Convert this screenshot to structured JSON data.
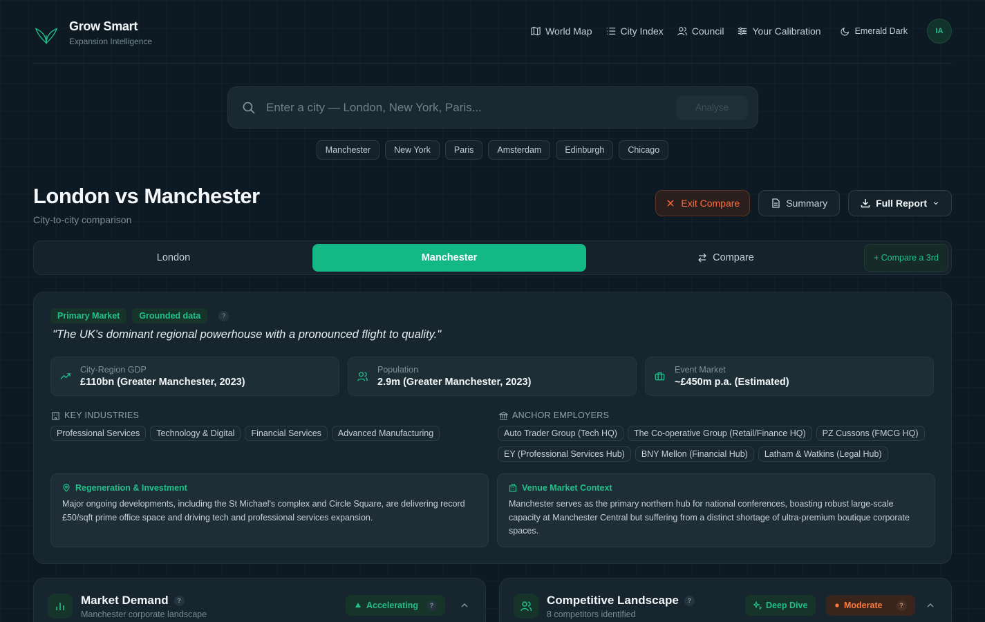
{
  "brand": {
    "name": "Grow Smart",
    "tagline": "Expansion Intelligence"
  },
  "nav": {
    "items": [
      {
        "label": "World Map",
        "icon": "map-icon"
      },
      {
        "label": "City Index",
        "icon": "list-icon"
      },
      {
        "label": "Council",
        "icon": "users-icon"
      },
      {
        "label": "Your Calibration",
        "icon": "sliders-icon"
      }
    ],
    "theme_label": "Emerald Dark",
    "avatar_initials": "IA"
  },
  "search": {
    "placeholder": "Enter a city — London, New York, Paris...",
    "value": "",
    "button_label": "Analyse"
  },
  "quick_cities": [
    "Manchester",
    "New York",
    "Paris",
    "Amsterdam",
    "Edinburgh",
    "Chicago"
  ],
  "page": {
    "title": "London vs Manchester",
    "subtitle": "City-to-city comparison"
  },
  "actions": {
    "exit": "Exit Compare",
    "summary": "Summary",
    "report": "Full Report"
  },
  "tabs": {
    "london": "London",
    "manchester": "Manchester",
    "compare": "Compare",
    "compare_third": "+ Compare a 3rd",
    "active": "Manchester"
  },
  "profile": {
    "badges": [
      "Primary Market",
      "Grounded data"
    ],
    "help": "?",
    "quote": "\"The UK's dominant regional powerhouse with a pronounced flight to quality.\"",
    "stats": [
      {
        "label": "City-Region GDP",
        "value": "£110bn (Greater Manchester, 2023)",
        "icon": "trend-up-icon"
      },
      {
        "label": "Population",
        "value": "2.9m (Greater Manchester, 2023)",
        "icon": "users-icon"
      },
      {
        "label": "Event Market",
        "value": "~£450m p.a. (Estimated)",
        "icon": "briefcase-icon"
      }
    ],
    "industries_label": "KEY INDUSTRIES",
    "industries": [
      "Professional Services",
      "Technology & Digital",
      "Financial Services",
      "Advanced Manufacturing"
    ],
    "employers_label": "ANCHOR EMPLOYERS",
    "employers": [
      "Auto Trader Group (Tech HQ)",
      "The Co-operative Group (Retail/Finance HQ)",
      "PZ Cussons (FMCG HQ)",
      "EY (Professional Services Hub)",
      "BNY Mellon (Financial Hub)",
      "Latham & Watkins (Legal Hub)"
    ],
    "regeneration": {
      "title": "Regeneration & Investment",
      "body": "Major ongoing developments, including the St Michael's complex and Circle Square, are delivering record £50/sqft prime office space and driving tech and professional services expansion."
    },
    "venue": {
      "title": "Venue Market Context",
      "body": "Manchester serves as the primary northern hub for national conferences, boasting robust large-scale capacity at Manchester Central but suffering from a distinct shortage of ultra-premium boutique corporate spaces."
    }
  },
  "market_demand": {
    "title": "Market Demand",
    "subtitle": "Manchester corporate landscape",
    "status": "Accelerating",
    "help": "?"
  },
  "competitive": {
    "title": "Competitive Landscape",
    "subtitle": "8 competitors identified",
    "deep_dive": "Deep Dive",
    "status": "Moderate",
    "help": "?"
  },
  "colors": {
    "accent": "#14b885",
    "accent_text": "#22c08a",
    "warning": "#ff6a3c",
    "background": "#0d1a24",
    "card": "#17252e"
  }
}
